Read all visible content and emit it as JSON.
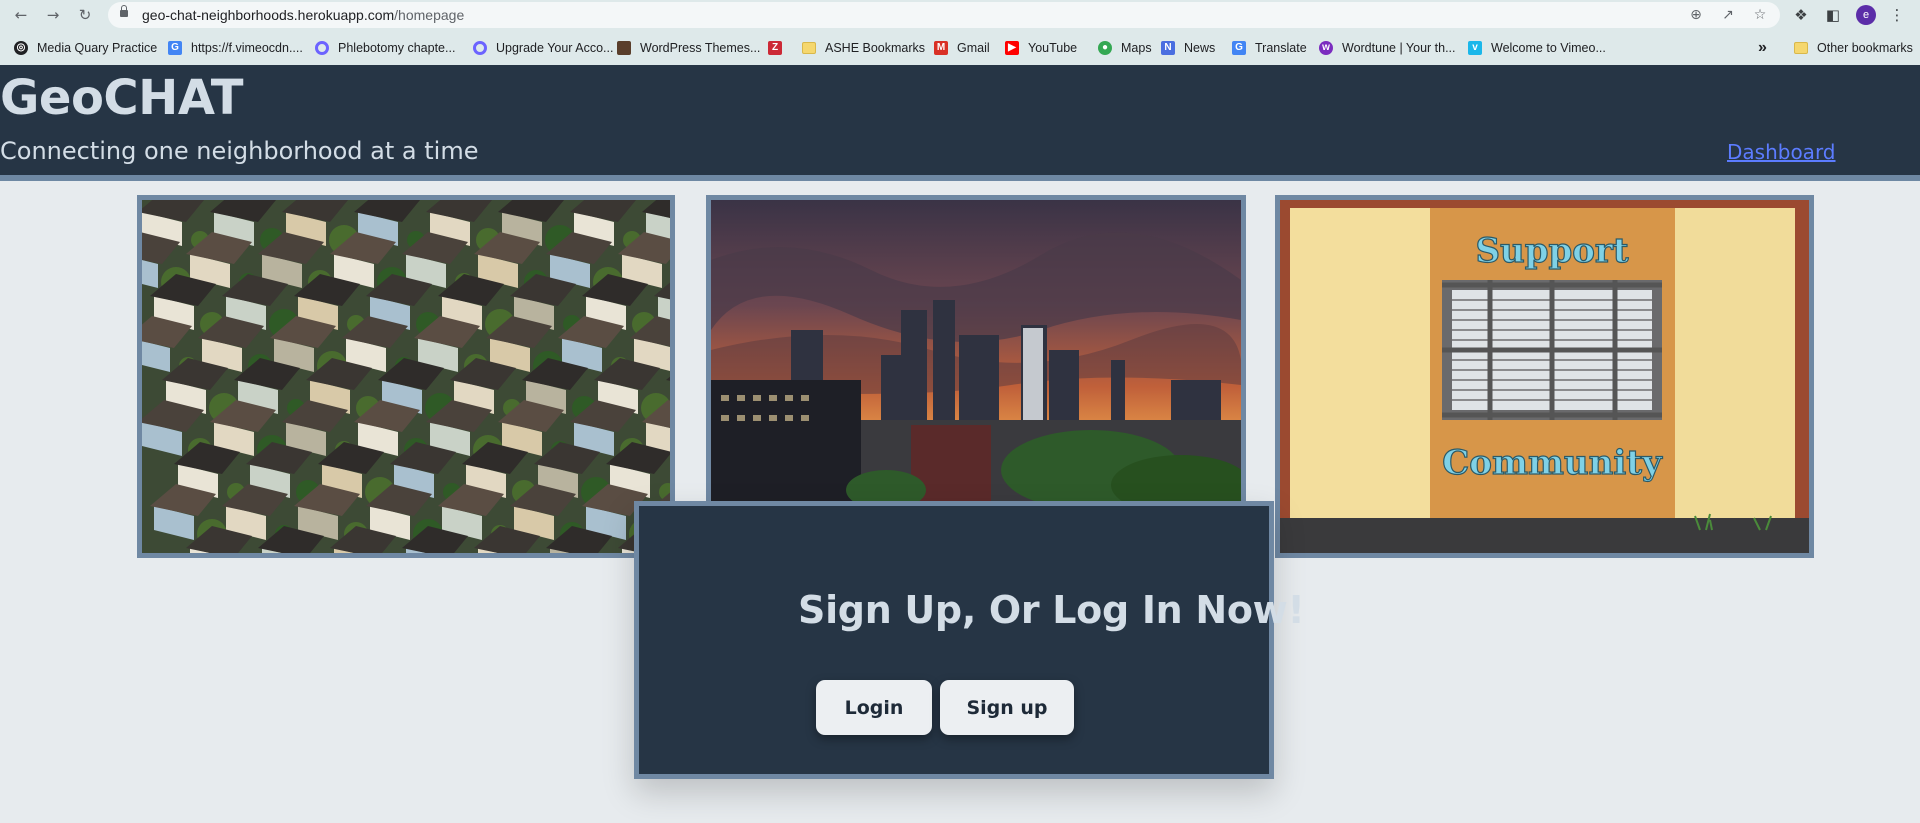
{
  "browser": {
    "url_host": "geo-chat-neighborhoods.herokuapp.com",
    "url_path": "/homepage",
    "profile_initial": "e",
    "bookmarks": [
      {
        "label": "Media Quary Practice",
        "icon": "globe-icon",
        "color": "#202124"
      },
      {
        "label": "https://f.vimeocdn....",
        "icon": "google-icon",
        "color": "#4285f4"
      },
      {
        "label": "Phlebotomy chapte...",
        "icon": "quizlet-icon",
        "color": "#6c63ff"
      },
      {
        "label": "Upgrade Your Acco...",
        "icon": "quizlet-icon",
        "color": "#6c63ff"
      },
      {
        "label": "WordPress Themes...",
        "icon": "site-icon",
        "color": "#5a3e2b"
      },
      {
        "label": "",
        "icon": "zotero-icon",
        "color": "#cc2936"
      },
      {
        "label": "ASHE Bookmarks",
        "icon": "folder-icon",
        "color": "#f5d76e"
      },
      {
        "label": "Gmail",
        "icon": "gmail-icon",
        "color": "#d93025"
      },
      {
        "label": "YouTube",
        "icon": "youtube-icon",
        "color": "#ff0000"
      },
      {
        "label": "Maps",
        "icon": "maps-icon",
        "color": "#34a853"
      },
      {
        "label": "News",
        "icon": "news-icon",
        "color": "#4a6ee0"
      },
      {
        "label": "Translate",
        "icon": "translate-icon",
        "color": "#4285f4"
      },
      {
        "label": "Wordtune | Your th...",
        "icon": "wordtune-icon",
        "color": "#7b2cbf"
      },
      {
        "label": "Welcome to Vimeo...",
        "icon": "vimeo-icon",
        "color": "#1ab7ea"
      }
    ],
    "more_bookmarks_glyph": "»",
    "other_bookmarks": "Other bookmarks"
  },
  "site": {
    "logo": "GeoCHAT",
    "tagline": "Connecting one neighborhood at a time",
    "dashboard_link": "Dashboard"
  },
  "photos": [
    {
      "subject": "aerial view of suburban neighborhood houses"
    },
    {
      "subject": "city skyline at sunset"
    },
    {
      "subject": "painted wall with barred window",
      "wall_text_top": "Support",
      "wall_text_bottom": "Community"
    }
  ],
  "auth": {
    "title": "Sign Up, Or Log In Now!",
    "login_label": "Login",
    "signup_label": "Sign up"
  },
  "colors": {
    "header_bg": "#263545",
    "header_text": "#d3dde6",
    "border_accent": "#6f88a3",
    "page_bg": "#e7ebee",
    "link": "#5c7cff"
  }
}
